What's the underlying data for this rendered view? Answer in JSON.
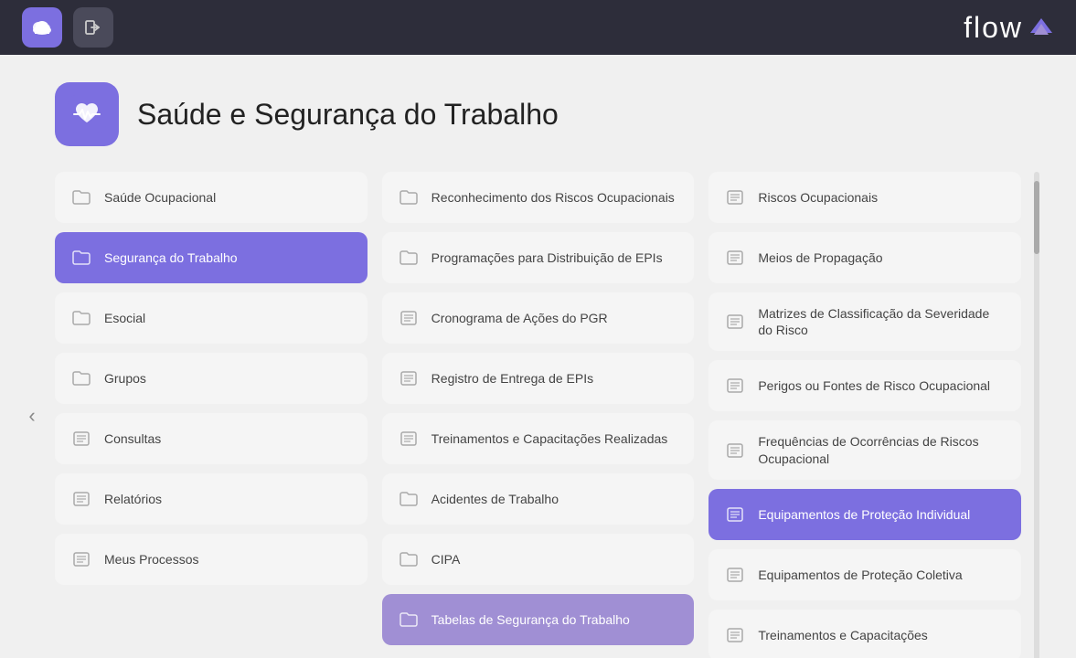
{
  "header": {
    "logo_text": "flow",
    "cloud_icon": "cloud-icon",
    "logout_icon": "logout-icon"
  },
  "page": {
    "title": "Saúde e Segurança do Trabalho",
    "icon": "heart-monitor-icon"
  },
  "columns": [
    {
      "id": "col1",
      "items": [
        {
          "id": "saude-ocupacional",
          "label": "Saúde Ocupacional",
          "icon": "folder-icon",
          "active": false
        },
        {
          "id": "seguranca-trabalho",
          "label": "Segurança do Trabalho",
          "icon": "folder-icon",
          "active": true,
          "activeClass": "active-purple"
        },
        {
          "id": "esocial",
          "label": "Esocial",
          "icon": "folder-icon",
          "active": false
        },
        {
          "id": "grupos",
          "label": "Grupos",
          "icon": "folder-icon",
          "active": false
        },
        {
          "id": "consultas",
          "label": "Consultas",
          "icon": "list-icon",
          "active": false
        },
        {
          "id": "relatorios",
          "label": "Relatórios",
          "icon": "list-icon",
          "active": false
        },
        {
          "id": "meus-processos",
          "label": "Meus Processos",
          "icon": "list-icon",
          "active": false
        }
      ]
    },
    {
      "id": "col2",
      "items": [
        {
          "id": "reconhecimento-riscos",
          "label": "Reconhecimento dos Riscos Ocupacionais",
          "icon": "folder-icon",
          "active": false
        },
        {
          "id": "programacoes-distribuicao",
          "label": "Programações para Distribuição de EPIs",
          "icon": "folder-icon",
          "active": false
        },
        {
          "id": "cronograma-acoes",
          "label": "Cronograma de Ações do PGR",
          "icon": "list-icon",
          "active": false
        },
        {
          "id": "registro-entrega",
          "label": "Registro de Entrega de EPIs",
          "icon": "list-icon",
          "active": false
        },
        {
          "id": "treinamentos",
          "label": "Treinamentos e Capacitações Realizadas",
          "icon": "list-icon",
          "active": false
        },
        {
          "id": "acidentes-trabalho",
          "label": "Acidentes de Trabalho",
          "icon": "folder-icon",
          "active": false
        },
        {
          "id": "cipa",
          "label": "CIPA",
          "icon": "folder-icon",
          "active": false
        },
        {
          "id": "tabelas-seguranca",
          "label": "Tabelas de Segurança do Trabalho",
          "icon": "folder-icon",
          "active": true,
          "activeClass": "active-medium-purple"
        }
      ]
    },
    {
      "id": "col3",
      "items": [
        {
          "id": "riscos-ocupacionais",
          "label": "Riscos Ocupacionais",
          "icon": "list-icon",
          "active": false
        },
        {
          "id": "meios-propagacao",
          "label": "Meios de Propagação",
          "icon": "list-icon",
          "active": false
        },
        {
          "id": "matrizes-classificacao",
          "label": "Matrizes de Classificação da Severidade do Risco",
          "icon": "list-icon",
          "active": false
        },
        {
          "id": "perigos-fontes",
          "label": "Perigos ou Fontes de Risco Ocupacional",
          "icon": "list-icon",
          "active": false
        },
        {
          "id": "frequencias-ocorrencias",
          "label": "Frequências de Ocorrências de Riscos Ocupacional",
          "icon": "list-icon",
          "active": false
        },
        {
          "id": "equipamentos-individual",
          "label": "Equipamentos de Proteção Individual",
          "icon": "list-icon",
          "active": true,
          "activeClass": "active-purple"
        },
        {
          "id": "equipamentos-coletiva",
          "label": "Equipamentos de Proteção Coletiva",
          "icon": "list-icon",
          "active": false
        },
        {
          "id": "treinamentos-capacitacoes",
          "label": "Treinamentos e Capacitações",
          "icon": "list-icon",
          "active": false
        }
      ]
    }
  ],
  "nav": {
    "left_arrow": "‹"
  }
}
